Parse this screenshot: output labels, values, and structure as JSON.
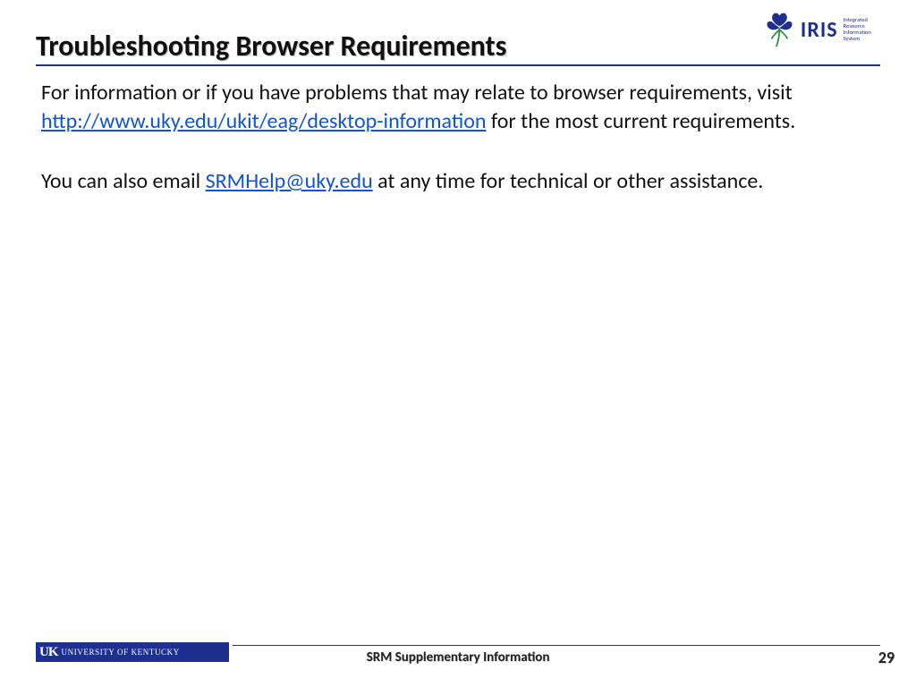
{
  "header": {
    "title": "Troubleshooting Browser Requirements",
    "logo_text": "IRIS",
    "logo_sub_line1": "Integrated Resource",
    "logo_sub_line2": "Information System"
  },
  "body": {
    "p1a": "For information or if you have problems that may relate to browser requirements, visit ",
    "p1_link": "http://www.uky.edu/ukit/eag/desktop-information",
    "p1b": " for the most current requirements.",
    "p2a": "You can also email ",
    "p2_link": "SRMHelp@uky.edu",
    "p2b": " at any time for technical or other assistance."
  },
  "footer": {
    "uk_mono": "UK",
    "uk_label": "UNIVERSITY OF KENTUCKY",
    "center": "SRM Supplementary Information",
    "page": "29"
  }
}
